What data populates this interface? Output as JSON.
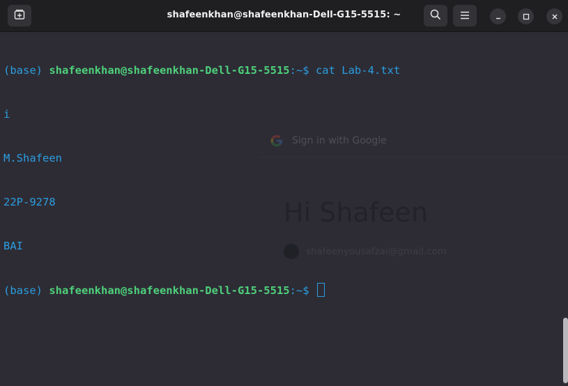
{
  "window": {
    "title": "shafeenkhan@shafeenkhan-Dell-G15-5515: ~",
    "new_tab_icon": "new-tab-icon",
    "search_icon": "search-icon",
    "menu_icon": "hamburger-menu-icon",
    "minimize_icon": "minimize-icon",
    "maximize_icon": "maximize-icon",
    "close_icon": "close-icon"
  },
  "terminal": {
    "colors": {
      "background": "#2d2c35",
      "prompt_env": "#2b9ee0",
      "prompt_user": "#4ed07a",
      "text": "#2b9ee0"
    },
    "lines": [
      {
        "env": "(base) ",
        "user": "shafeenkhan@shafeenkhan-Dell-G15-5515",
        "path": ":~$ ",
        "cmd": "cat Lab-4.txt"
      },
      {
        "out": "i"
      },
      {
        "out": "M.Shafeen"
      },
      {
        "out": "22P-9278"
      },
      {
        "out": "BAI"
      },
      {
        "env": "(base) ",
        "user": "shafeenkhan@shafeenkhan-Dell-G15-5515",
        "path": ":~$ ",
        "cmd": ""
      }
    ]
  },
  "google_overlay": {
    "signin_label": "Sign in with Google",
    "greeting": "Hi Shafeen",
    "email": "shafeenyousafzai@gmail.com"
  }
}
